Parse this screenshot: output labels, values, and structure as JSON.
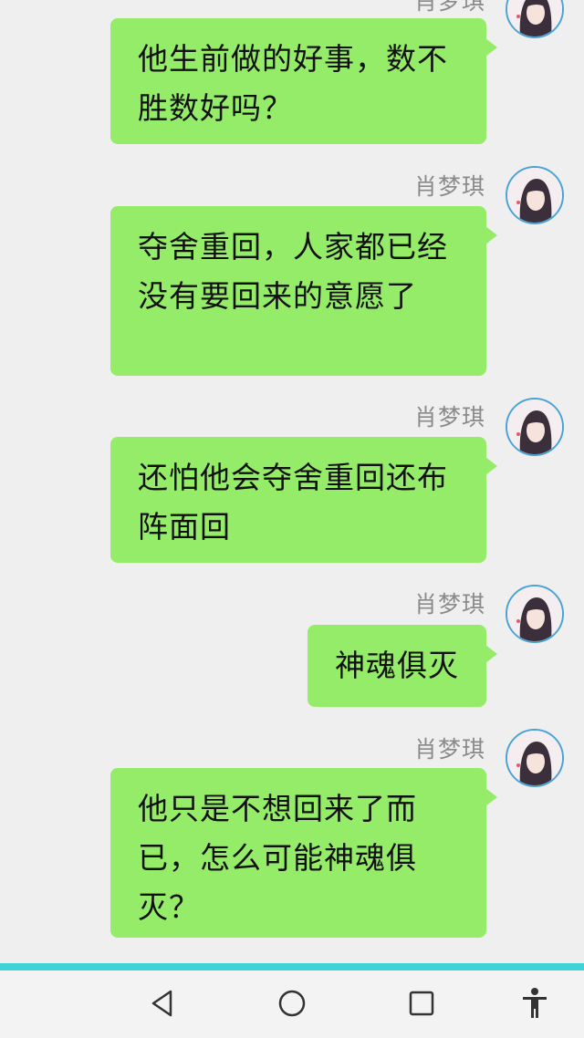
{
  "messages": [
    {
      "sender": "肖梦琪",
      "text": "他生前做的好事，数不胜数好吗？"
    },
    {
      "sender": "肖梦琪",
      "text": "夺舍重回，人家都已经没有要回来的意愿了"
    },
    {
      "sender": "肖梦琪",
      "text": "还怕他会夺舍重回还布阵面回"
    },
    {
      "sender": "肖梦琪",
      "text": "神魂俱灭"
    },
    {
      "sender": "肖梦琪",
      "text": "他只是不想回来了而已，怎么可能神魂俱灭？"
    }
  ],
  "nav": {
    "back_icon": "triangle-back-icon",
    "home_icon": "circle-home-icon",
    "recents_icon": "square-recents-icon",
    "accessibility_icon": "accessibility-person-icon"
  },
  "colors": {
    "bubble": "#95ec69",
    "background": "#efefef",
    "accent_bar": "#3fd3d8"
  }
}
